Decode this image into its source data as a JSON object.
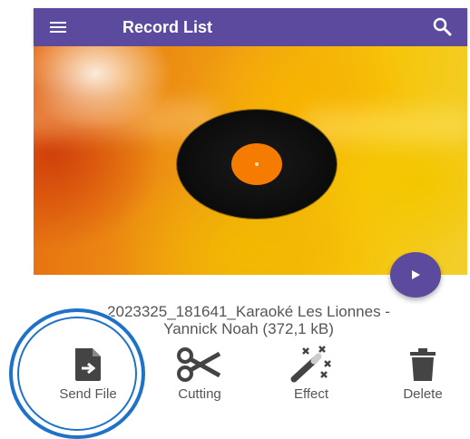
{
  "appbar": {
    "title": "Record List",
    "color": "#5c4a9e"
  },
  "player": {
    "play_icon": "play-icon"
  },
  "record": {
    "filename_line1": "2023325_181641_Karaoké Les Lionnes -",
    "filename_line2": "Yannick Noah  (372,1 kB)"
  },
  "actions": [
    {
      "label": "Send File",
      "icon": "send-file-icon"
    },
    {
      "label": "Cutting",
      "icon": "scissors-icon"
    },
    {
      "label": "Effect",
      "icon": "magic-wand-icon"
    },
    {
      "label": "Delete",
      "icon": "trash-icon"
    }
  ],
  "highlight": {
    "target": "Send File",
    "color": "#1e73c8"
  }
}
